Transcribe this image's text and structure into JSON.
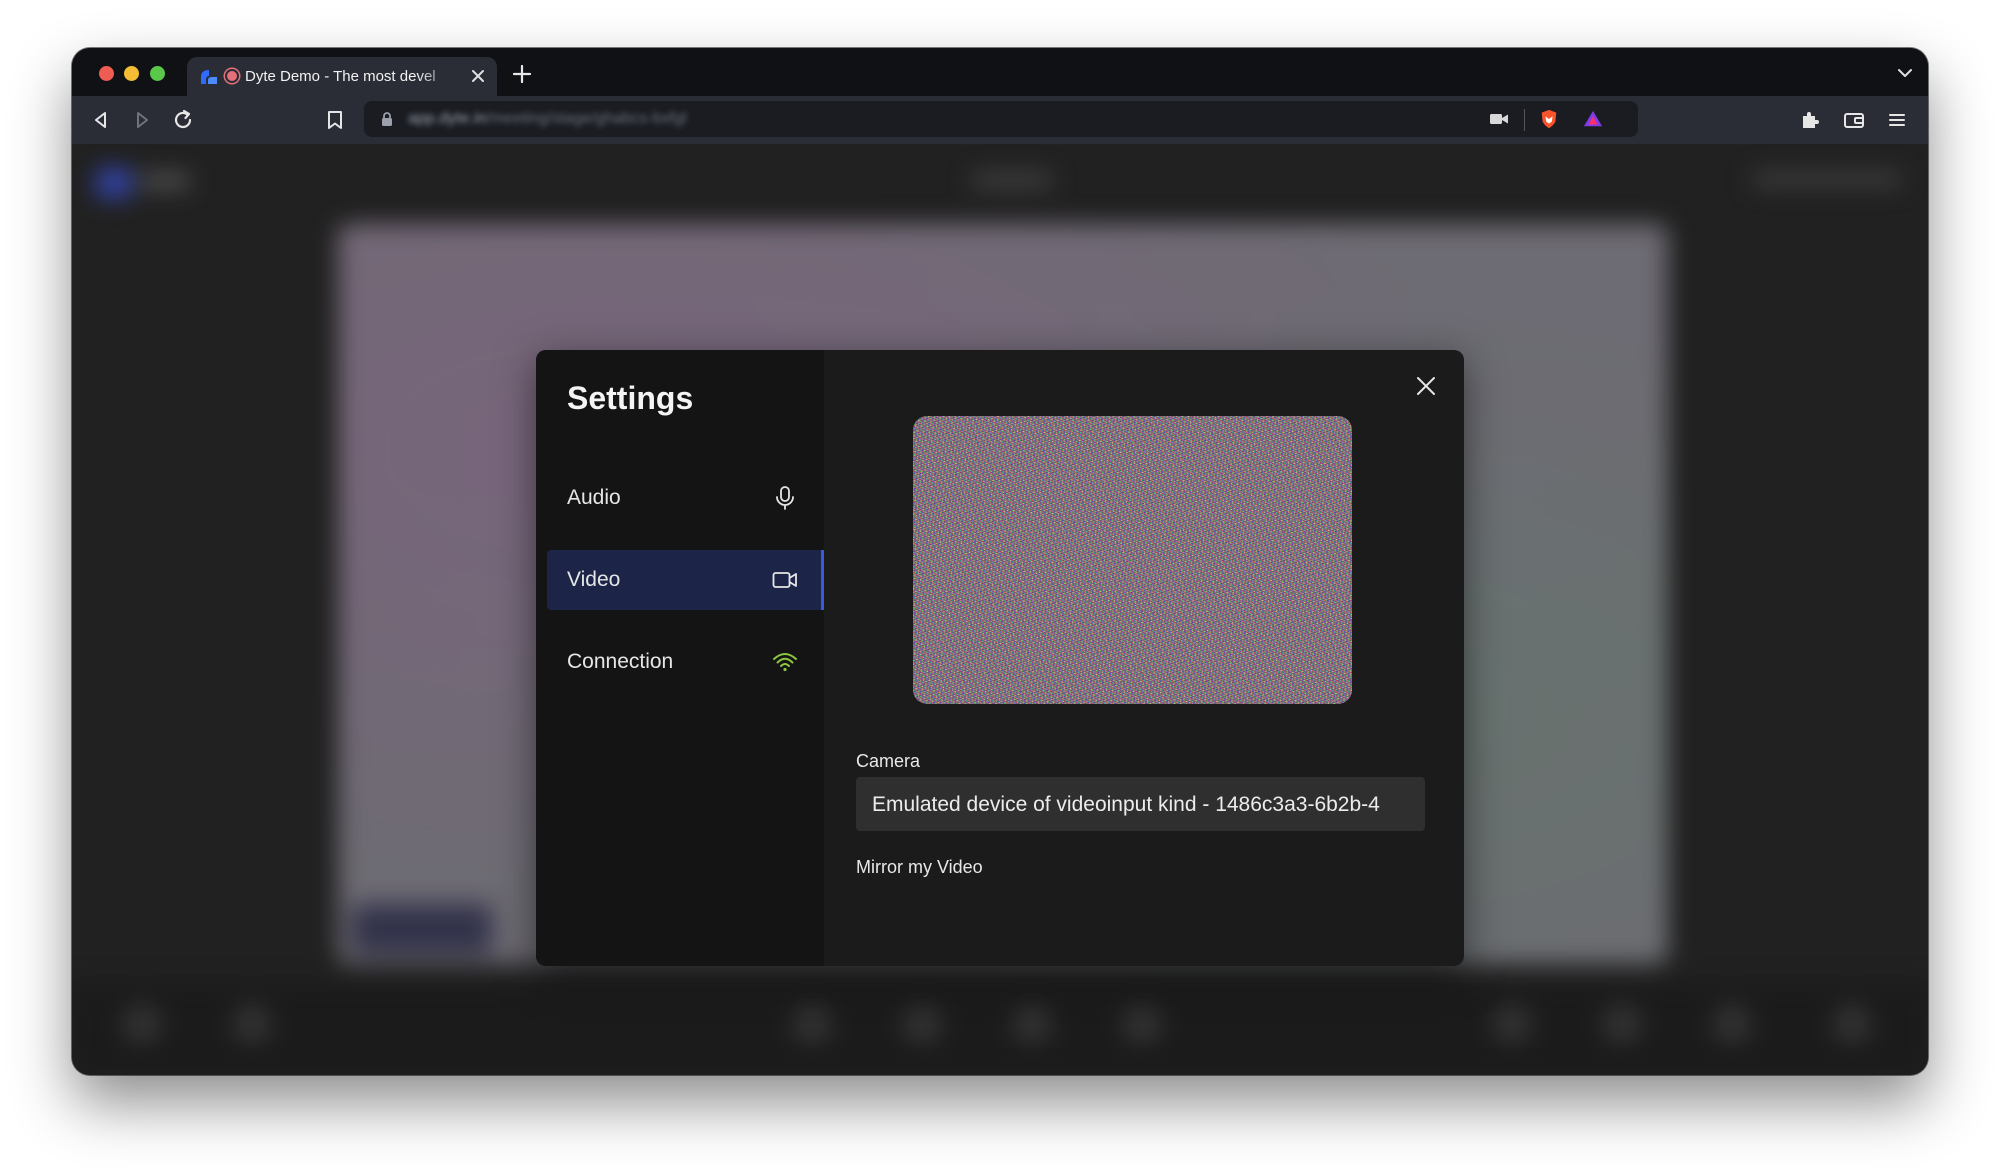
{
  "browser": {
    "tab": {
      "title": "Dyte Demo - The most devel"
    },
    "address": {
      "host": "app.dyte.in",
      "path": "/meeting/stage/ghabcs-bxfgl"
    }
  },
  "settings": {
    "title": "Settings",
    "nav": [
      {
        "label": "Audio",
        "icon": "microphone-icon",
        "active": false
      },
      {
        "label": "Video",
        "icon": "video-camera-icon",
        "active": true
      },
      {
        "label": "Connection",
        "icon": "wifi-icon",
        "active": false,
        "icon_color": "#8ec63f"
      }
    ],
    "video": {
      "camera_label": "Camera",
      "camera_value": "Emulated device of videoinput kind - 1486c3a3-6b2b-4",
      "mirror_label": "Mirror my Video"
    }
  },
  "colors": {
    "active_nav": "#1c2448",
    "accent": "#3a5bd9",
    "wifi": "#8ec63f"
  }
}
